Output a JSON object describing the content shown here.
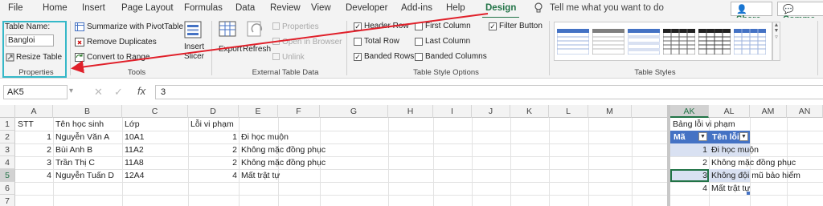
{
  "tabs": [
    "File",
    "Home",
    "Insert",
    "Page Layout",
    "Formulas",
    "Data",
    "Review",
    "View",
    "Developer",
    "Add-ins",
    "Help",
    "Design"
  ],
  "tell_me": "Tell me what you want to do",
  "share_label": "Share",
  "comments_label": "Comme",
  "ribbon": {
    "properties": {
      "table_name_label": "Table Name:",
      "table_name_value": "Bangloi",
      "resize_label": "Resize Table",
      "group_label": "Properties"
    },
    "tools": {
      "summarize": "Summarize with PivotTable",
      "remove_dup": "Remove Duplicates",
      "convert": "Convert to Range",
      "insert_slicer_1": "Insert",
      "insert_slicer_2": "Slicer",
      "group_label": "Tools"
    },
    "external": {
      "export": "Export",
      "refresh": "Refresh",
      "properties": "Properties",
      "open_browser": "Open in Browser",
      "unlink": "Unlink",
      "group_label": "External Table Data"
    },
    "style_options": {
      "header_row": "Header Row",
      "total_row": "Total Row",
      "banded_rows": "Banded Rows",
      "first_column": "First Column",
      "last_column": "Last Column",
      "banded_columns": "Banded Columns",
      "filter_button": "Filter Button",
      "group_label": "Table Style Options"
    },
    "styles": {
      "group_label": "Table Styles"
    }
  },
  "formula_bar": {
    "name_box": "AK5",
    "fx": "fx",
    "value": "3"
  },
  "columns_left": [
    "A",
    "B",
    "C",
    "D",
    "E",
    "F",
    "G",
    "H",
    "I",
    "J",
    "K",
    "L",
    "M"
  ],
  "columns_right": [
    "AK",
    "AL",
    "AM",
    "AN"
  ],
  "rows": [
    "1",
    "2",
    "3",
    "4",
    "5",
    "6",
    "7"
  ],
  "sheet": {
    "headers": {
      "a": "STT",
      "b": "Tên học sinh",
      "c": "Lớp",
      "d": "Lỗi vi phạm"
    },
    "records": [
      {
        "stt": "1",
        "name": "Nguyễn Văn A",
        "cls": "10A1",
        "code": "1",
        "err": "Đi học muộn"
      },
      {
        "stt": "2",
        "name": "Bùi Anh B",
        "cls": "11A2",
        "code": "2",
        "err": "Không mặc đồng phục"
      },
      {
        "stt": "3",
        "name": "Trần Thị C",
        "cls": "11A8",
        "code": "2",
        "err": "Không mặc đồng phục"
      },
      {
        "stt": "4",
        "name": "Nguyễn Tuấn D",
        "cls": "12A4",
        "code": "4",
        "err": "Mất trật tự"
      }
    ],
    "lookup": {
      "title": "Bảng lỗi vi phạm",
      "col_ma": "Mã",
      "col_ten": "Tên lỗi",
      "items": [
        {
          "ma": "1",
          "ten": "Đi học muộn"
        },
        {
          "ma": "2",
          "ten": "Không mặc đồng phục"
        },
        {
          "ma": "3",
          "ten": "Không đội mũ bảo hiểm"
        },
        {
          "ma": "4",
          "ten": "Mất trật tự"
        }
      ]
    }
  },
  "colors": {
    "accent": "#217346",
    "table_header": "#4472c4",
    "table_band": "#d9e1f2",
    "annotation": "#e0202a"
  }
}
